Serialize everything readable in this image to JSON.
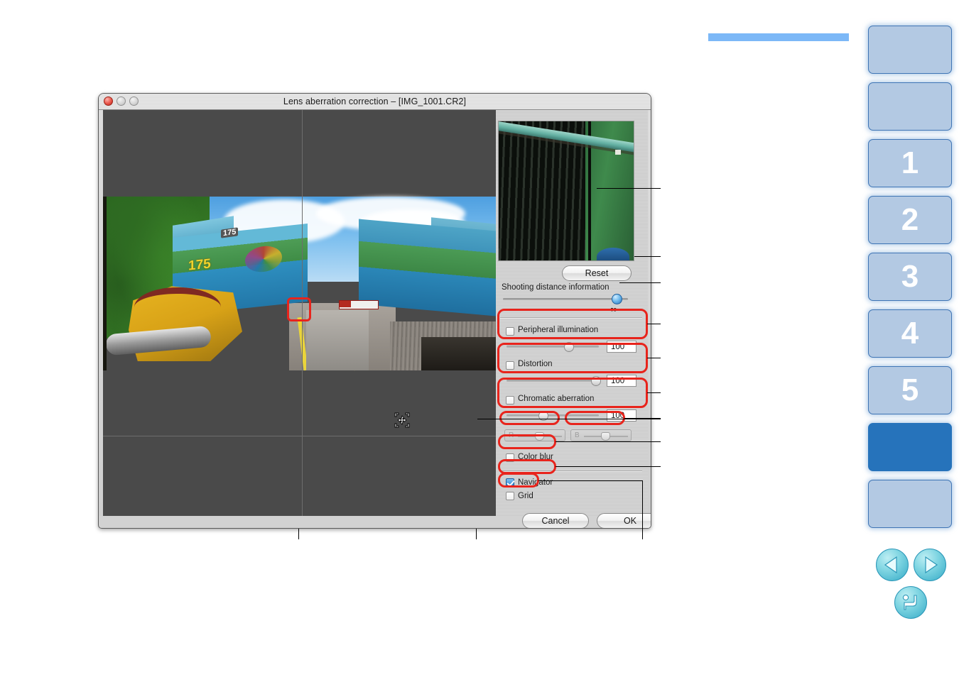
{
  "window": {
    "title": "Lens aberration correction – [IMG_1001.CR2]",
    "traffic_lights": [
      "close",
      "minimize",
      "zoom"
    ]
  },
  "panel": {
    "navigator_thumbnail": "navigator-preview-image",
    "reset_label": "Reset",
    "shooting_distance": {
      "label": "Shooting distance information",
      "value_label": "∞",
      "slider_position_pct": 92
    },
    "corrections": [
      {
        "id": "peripheral-illumination",
        "label": "Peripheral illumination",
        "checked": false,
        "value": "100",
        "slider_position_pct": 63
      },
      {
        "id": "distortion",
        "label": "Distortion",
        "checked": false,
        "value": "100",
        "slider_position_pct": 97
      },
      {
        "id": "chromatic-aberration",
        "label": "Chromatic aberration",
        "checked": false,
        "value": "100",
        "slider_position_pct": 38
      }
    ],
    "rb_sliders": [
      {
        "id": "r-slider",
        "label": "R",
        "position_pct": 50,
        "enabled": false
      },
      {
        "id": "b-slider",
        "label": "B",
        "position_pct": 50,
        "enabled": false
      }
    ],
    "checkboxes": [
      {
        "id": "color-blur",
        "label": "Color blur",
        "checked": false
      },
      {
        "id": "navigator",
        "label": "Navigator",
        "checked": true
      },
      {
        "id": "grid",
        "label": "Grid",
        "checked": false
      }
    ],
    "cancel_label": "Cancel",
    "ok_label": "OK"
  },
  "image_area": {
    "cursor_icon": "move-cursor-icon",
    "photo_caption": "locomotive-photo",
    "locomotive_number": "175"
  },
  "manual_nav": {
    "tabs": [
      {
        "id": "tab-cover",
        "label": "",
        "active": false
      },
      {
        "id": "tab-contents",
        "label": "",
        "active": false
      },
      {
        "id": "tab-1",
        "label": "1",
        "active": false
      },
      {
        "id": "tab-2",
        "label": "2",
        "active": false
      },
      {
        "id": "tab-3",
        "label": "3",
        "active": false
      },
      {
        "id": "tab-4",
        "label": "4",
        "active": false
      },
      {
        "id": "tab-5",
        "label": "5",
        "active": false
      },
      {
        "id": "tab-reference",
        "label": "",
        "active": true
      },
      {
        "id": "tab-index",
        "label": "",
        "active": false
      }
    ],
    "buttons": [
      {
        "id": "prev-page-button",
        "icon": "triangle-left-icon"
      },
      {
        "id": "next-page-button",
        "icon": "triangle-right-icon"
      },
      {
        "id": "back-button",
        "icon": "return-arrow-icon"
      }
    ]
  },
  "colors": {
    "accent_blue": "#2673bb",
    "tab_blue": "#b3c9e3",
    "annotation_red": "#e8241c",
    "top_bar_blue": "#7cb8f7"
  }
}
